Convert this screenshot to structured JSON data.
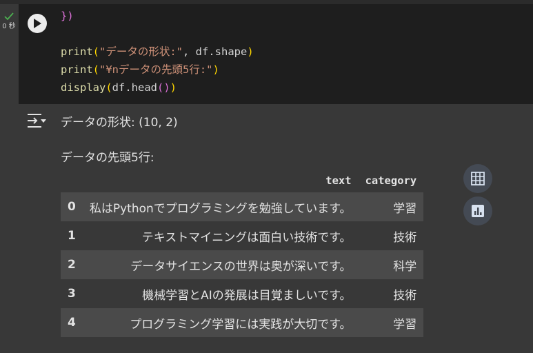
{
  "cell": {
    "status_icon": "check-icon",
    "exec_time": "0 秒",
    "run_icon": "play-icon",
    "code": {
      "line1": "})",
      "line2": "",
      "line3_fn": "print",
      "line3_str": "\"データの形状:\"",
      "line3_rest": ", df.shape",
      "line4_fn": "print",
      "line4_str": "\"¥nデータの先頭5行:\"",
      "line5_fn": "display",
      "line5_rest": "df.head"
    }
  },
  "output": {
    "icon": "output-toggle-icon",
    "shape_line": "データの形状: (10, 2)",
    "head_line": "データの先頭5行:",
    "table": {
      "columns": [
        "",
        "text",
        "category"
      ],
      "rows": [
        {
          "index": "0",
          "text": "私はPythonでプログラミングを勉強しています。",
          "category": "学習"
        },
        {
          "index": "1",
          "text": "テキストマイニングは面白い技術です。",
          "category": "技術"
        },
        {
          "index": "2",
          "text": "データサイエンスの世界は奥が深いです。",
          "category": "科学"
        },
        {
          "index": "3",
          "text": "機械学習とAIの発展は目覚ましいです。",
          "category": "技術"
        },
        {
          "index": "4",
          "text": "プログラミング学習には実践が大切です。",
          "category": "学習"
        }
      ]
    },
    "side_buttons": [
      "table-icon",
      "chart-icon"
    ]
  },
  "colors": {
    "background": "#383838",
    "code_bg": "#1e1e1e",
    "string": "#ce9178",
    "function": "#dcdcaa",
    "check": "#4caf50"
  }
}
